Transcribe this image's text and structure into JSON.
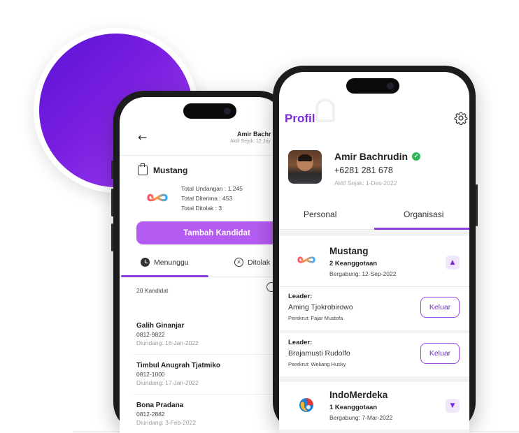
{
  "back_screen": {
    "back_icon": "arrow-left-icon",
    "user_name": "Amir Bachr",
    "active_since": "Aktif Sejak: 12 Jay",
    "org_icon": "id-badge-icon",
    "org_name": "Mustang",
    "stats": {
      "total_invites": "Total Undangan : 1.245",
      "total_accepted": "Total Diterima : 453",
      "total_rejected": "Total Ditolak : 3"
    },
    "add_candidate_button": "Tambah Kandidat",
    "tabs": [
      {
        "label": "Menunggu",
        "icon": "clock-icon",
        "active": true
      },
      {
        "label": "Ditolak",
        "icon": "x-circle-icon",
        "active": false
      }
    ],
    "candidate_count": "20 Kandidat",
    "candidates": [
      {
        "name": "Galih Ginanjar",
        "phone": "0812-9822",
        "invited": "Diundang: 16-Jan-2022"
      },
      {
        "name": "Timbul Anugrah Tjatmiko",
        "phone": "0812-1000",
        "invited": "Diundang: 17-Jan-2022"
      },
      {
        "name": "Bona Pradana",
        "phone": "0812-2882",
        "invited": "Diundang: 3-Feb-2022"
      }
    ]
  },
  "front_screen": {
    "title": "Profil",
    "settings_icon": "gear-icon",
    "profile": {
      "name": "Amir Bachrudin",
      "verified_icon": "check-badge-icon",
      "phone": "+6281  281 678",
      "active_since": "Aktif Sejak: 1-Des-2022"
    },
    "tabs": [
      {
        "label": "Personal",
        "active": false
      },
      {
        "label": "Organisasi",
        "active": true
      }
    ],
    "organizations": [
      {
        "name": "Mustang",
        "members": "2 Keanggotaan",
        "joined": "Bergabung:  12-Sep-2022",
        "expanded": true,
        "leaders": [
          {
            "label": "Leader:",
            "name": "Aming Tjokrobirowo",
            "recruiter": "Perekrut: Fajar Mustofa",
            "action": "Keluar"
          },
          {
            "label": "Leader:",
            "name": "Brajamusti Rudolfo",
            "recruiter": "Perekrut: Weliang Husky",
            "action": "Keluar"
          }
        ]
      },
      {
        "name": "IndoMerdeka",
        "members": "1 Keanggotaan",
        "joined": "Bergabung:  7-Mar-2022",
        "expanded": false
      }
    ]
  },
  "colors": {
    "brand_purple": "#7b2ad8",
    "button_purple": "#b45cf2",
    "verified_green": "#2fb55a",
    "blob_gradient_start": "#5a12d6",
    "blob_gradient_end": "#9d3ff0"
  }
}
